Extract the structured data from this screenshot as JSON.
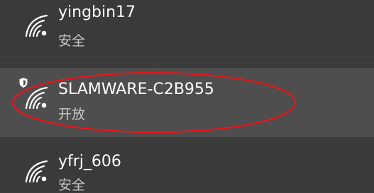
{
  "colors": {
    "panel_background": "#3c3c3c",
    "row_background": "#3a3a3a",
    "selected_row_background": "#4e4e4e",
    "ssid_text": "#ffffff",
    "security_text": "#c8c8c8",
    "annotation_ellipse": "#e0161d"
  },
  "networks": [
    {
      "ssid": "yingbin17",
      "security": "安全",
      "icon": "wifi-signal-icon"
    },
    {
      "ssid": "SLAMWARE-C2B955",
      "security": "开放",
      "icon": "wifi-signal-icon",
      "badge_icon": "open-network-shield-icon",
      "highlighted": true
    },
    {
      "ssid": "yfrj_606",
      "security": "安全",
      "icon": "wifi-signal-icon"
    }
  ]
}
